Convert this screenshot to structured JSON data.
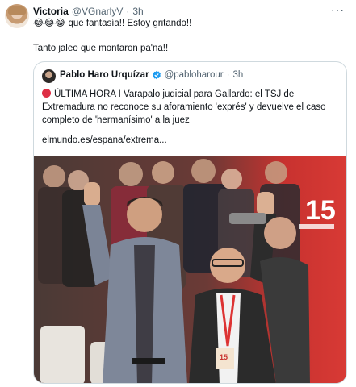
{
  "tweet": {
    "author_name": "Victoria",
    "author_handle": "@VGnarlyV",
    "separator": "·",
    "time": "3h",
    "more_icon": "more-horizontal-icon",
    "line1_emoji": "😂😂😂",
    "line1_text": " que fantasía!! Estoy gritando!!",
    "line2_text": "Tanto jaleo que montaron pa'na!!"
  },
  "quote": {
    "author_name": "Pablo Haro Urquízar",
    "author_handle": "@pabloharour",
    "separator": "·",
    "time": "3h",
    "verified_icon": "verified-badge-icon",
    "line1": "ÚLTIMA HORA I Varapalo judicial para Gallardo: el TSJ de",
    "line2": "Extremadura no reconoce su aforamiento 'exprés' y devuelve el caso",
    "line3": "completo de 'hermanísimo' a la juez",
    "link": "elmundo.es/espana/extrema...",
    "photo": {
      "backdrop_logo": "15",
      "badge_text": "15"
    }
  },
  "colors": {
    "text": "#0f1419",
    "secondary": "#536471",
    "border": "#cfd9de",
    "verified": "#1d9bf0",
    "stage_red": "#c8322f"
  }
}
